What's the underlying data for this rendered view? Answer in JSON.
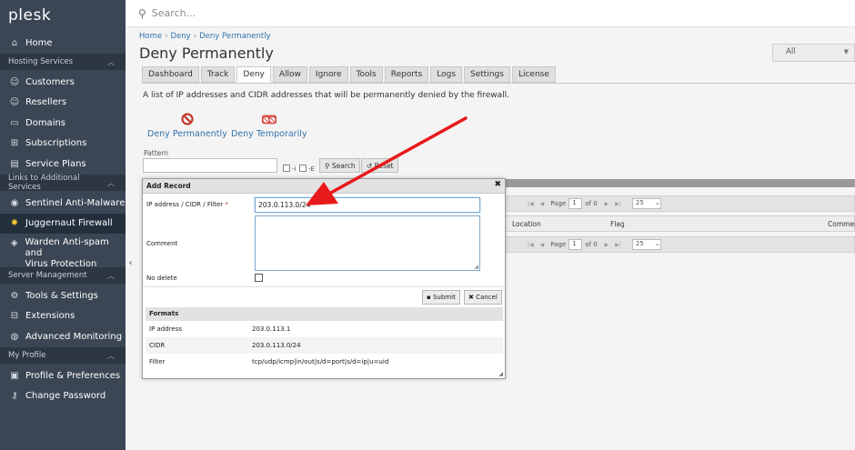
{
  "app": {
    "logo": "plesk"
  },
  "search": {
    "placeholder": "Search..."
  },
  "sidebar": {
    "home": "Home",
    "sections": {
      "hosting": "Hosting Services",
      "links": "Links to Additional Services",
      "server": "Server Management",
      "profile": "My Profile"
    },
    "hosting_items": [
      "Customers",
      "Resellers",
      "Domains",
      "Subscriptions",
      "Service Plans"
    ],
    "links_items": [
      "Sentinel Anti-Malware",
      "Juggernaut Firewall"
    ],
    "warden": {
      "line1": "Warden Anti-spam and",
      "line2": "Virus Protection"
    },
    "server_items": [
      "Tools & Settings",
      "Extensions",
      "Advanced Monitoring"
    ],
    "profile_items": [
      "Profile & Preferences",
      "Change Password"
    ]
  },
  "breadcrumb": [
    "Home",
    "Deny",
    "Deny Permanently"
  ],
  "page": {
    "title": "Deny Permanently",
    "filter_select": "All",
    "description": "A list of IP addresses and CIDR addresses that will be permanently denied by the firewall."
  },
  "tabs": [
    "Dashboard",
    "Track",
    "Deny",
    "Allow",
    "Ignore",
    "Tools",
    "Reports",
    "Logs",
    "Settings",
    "License"
  ],
  "actions": {
    "deny_permanently": "Deny Permanently",
    "deny_temporarily": "Deny Temporarily"
  },
  "filter": {
    "pattern_label": "Pattern",
    "flag_i": "-i",
    "flag_e": "-E",
    "search_button": "Search",
    "reset_button": "Reset"
  },
  "grid": {
    "page_label": "Page",
    "page_value": "1",
    "of_label": "of 0",
    "per_page": "25",
    "columns": {
      "location": "Location",
      "flag": "Flag",
      "comment": "Commen"
    }
  },
  "dialog": {
    "title": "Add Record",
    "ip_label": "IP address / CIDR / Filter",
    "required_mark": "*",
    "ip_value": "203.0.113.0/24",
    "comment_label": "Comment",
    "nodelete_label": "No delete",
    "submit": "Submit",
    "cancel": "Cancel",
    "formats_title": "Formats",
    "formats": [
      {
        "type": "IP address",
        "example": "203.0.113.1"
      },
      {
        "type": "CIDR",
        "example": "203.0.113.0/24"
      },
      {
        "type": "Filter",
        "example": "tcp/udp/icmp|in/out|s/d=port|s/d=ip|u=uid"
      }
    ]
  },
  "colors": {
    "sidebar": "#3b4654",
    "sidebar_active": "#23303c",
    "link": "#3273ae",
    "arrow": "#e8191b"
  }
}
